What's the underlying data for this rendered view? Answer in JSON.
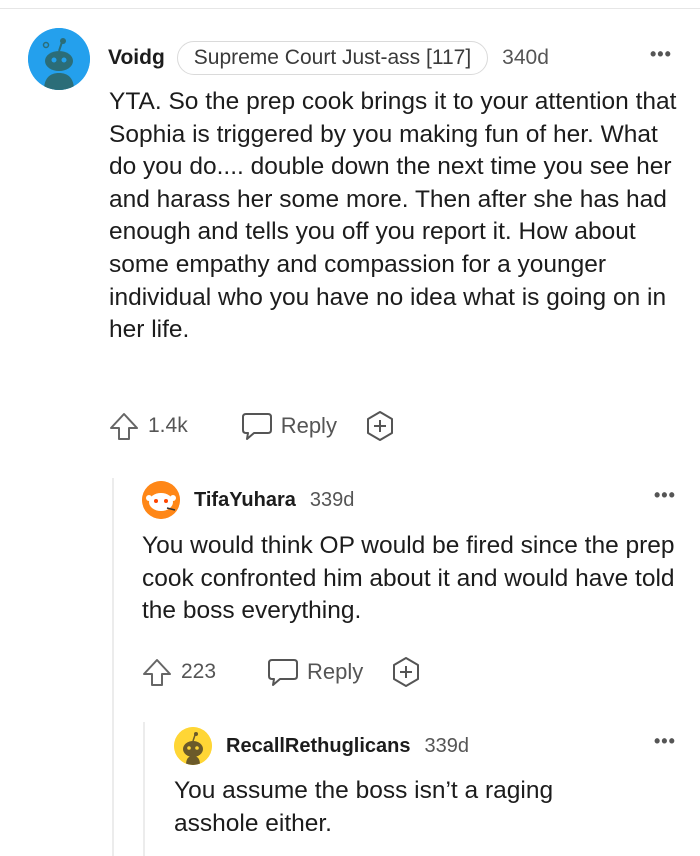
{
  "comments": [
    {
      "username": "Voidg",
      "flair": "Supreme Court Just-ass [117]",
      "age": "340d",
      "more": "•••",
      "body": "YTA. So the prep cook brings it to your attention that Sophia is triggered by you making fun of her. What do you do.... double down the next time you see her and harass her some more. Then after she has had enough and tells you off you report it. How about some empathy and compassion for a younger individual who you have no idea what is going on in her life.",
      "votes": "1.4k",
      "reply": "Reply",
      "avatar_color": "#24a0ed"
    },
    {
      "username": "TifaYuhara",
      "age": "339d",
      "more": "•••",
      "body": "You would think OP would be fired since the prep cook confronted him about it and would have told the boss everything.",
      "votes": "223",
      "reply": "Reply",
      "avatar_color": "#ff8717"
    },
    {
      "username": "RecallRethuglicans",
      "age": "339d",
      "more": "•••",
      "body": "You assume the boss isn’t a raging asshole either.",
      "avatar_color": "#ffd635"
    }
  ],
  "icons": [
    "upvote-icon",
    "comment-bubble-icon",
    "award-plus-icon",
    "more-options-icon",
    "snoo-avatar-icon"
  ]
}
